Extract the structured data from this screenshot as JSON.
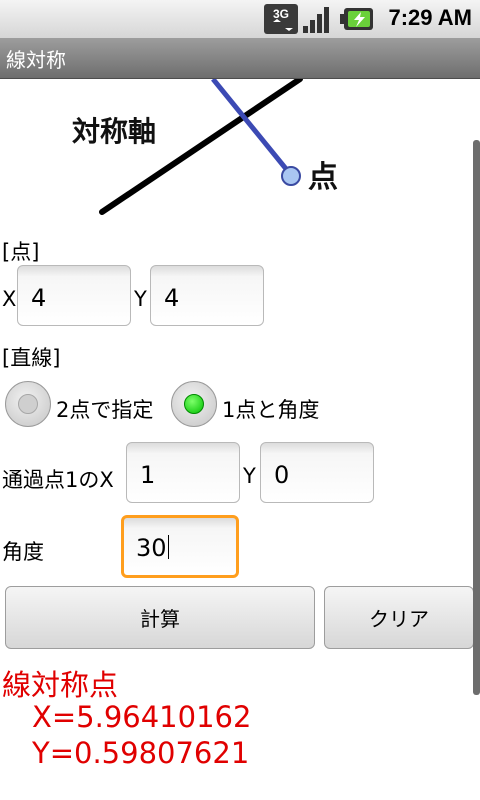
{
  "status_bar": {
    "time": "7:29 AM",
    "network_label": "3G"
  },
  "app": {
    "title": "線対称"
  },
  "diagram": {
    "axis_label": "対称軸",
    "point_label": "点"
  },
  "point": {
    "heading": "[点]",
    "x_label": "X",
    "x_value": "4",
    "y_label": "Y",
    "y_value": "4"
  },
  "line": {
    "heading": "[直線]",
    "radio_two_points": {
      "label": "2点で指定",
      "checked": false
    },
    "radio_point_angle": {
      "label": "1点と角度",
      "checked": true
    },
    "pass_point_x_label": "通過点1のX",
    "pass_point_x_value": "1",
    "pass_point_y_label": "Y",
    "pass_point_y_value": "0",
    "angle_label": "角度",
    "angle_value": "30"
  },
  "buttons": {
    "calculate": "計算",
    "clear": "クリア"
  },
  "result": {
    "title": "線対称点",
    "x": "X=5.96410162",
    "y": "Y=0.59807621"
  },
  "colors": {
    "result_text": "#e00000",
    "focus_border": "#ff9e1d",
    "radio_selected": "#00c000"
  }
}
